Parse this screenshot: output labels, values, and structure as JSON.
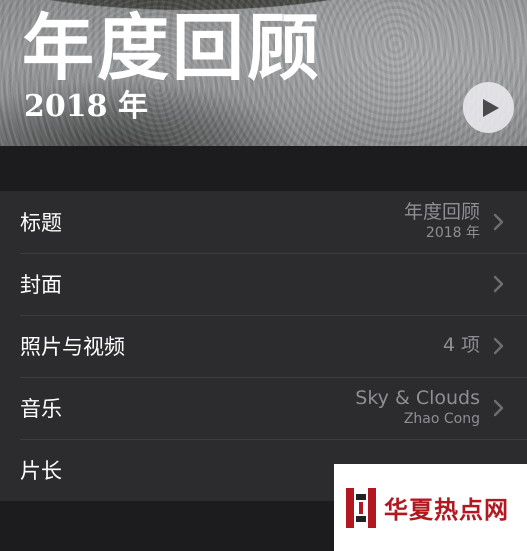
{
  "hero": {
    "title": "年度回顾",
    "subtitle": "2018 年",
    "play_icon": "play-icon"
  },
  "rows": [
    {
      "label": "标题",
      "value": "年度回顾",
      "sub": "2018 年"
    },
    {
      "label": "封面",
      "value": "",
      "sub": ""
    },
    {
      "label": "照片与视频",
      "value": "4 项",
      "sub": ""
    },
    {
      "label": "音乐",
      "value": "Sky & Clouds",
      "sub": "Zhao Cong"
    },
    {
      "label": "片长",
      "value": "",
      "sub": ""
    }
  ],
  "watermark": {
    "text": "华夏热点网"
  },
  "colors": {
    "background": "#1c1c1e",
    "cell": "#2c2c2e",
    "secondary_text": "#8e8e93",
    "watermark_red": "#b3171f"
  }
}
